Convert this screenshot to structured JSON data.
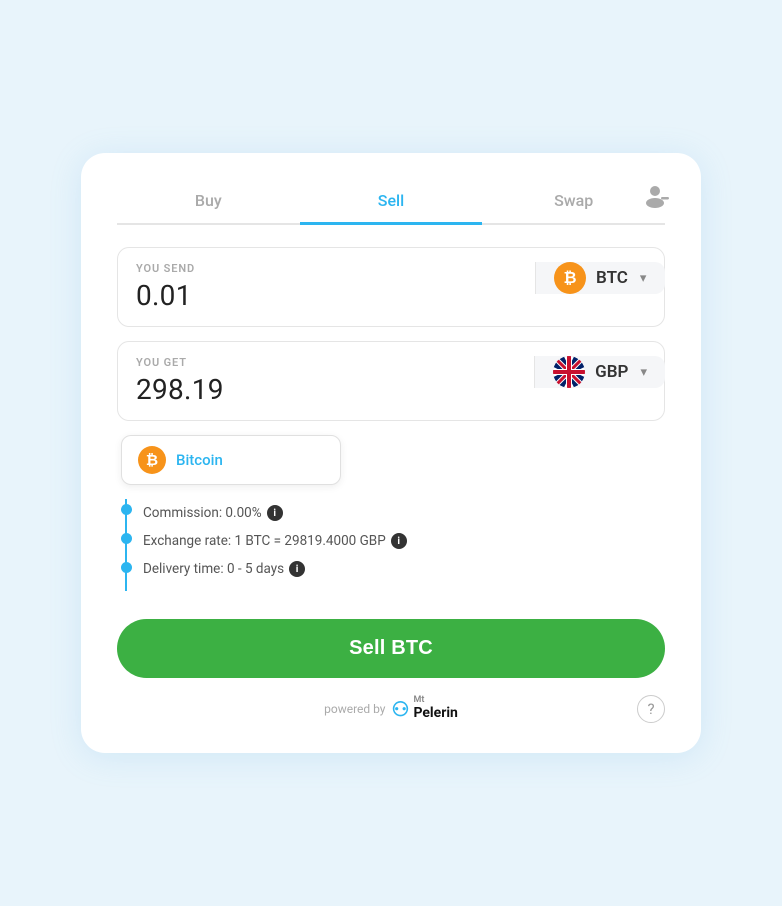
{
  "tabs": [
    {
      "id": "buy",
      "label": "Buy",
      "active": false
    },
    {
      "id": "sell",
      "label": "Sell",
      "active": true
    },
    {
      "id": "swap",
      "label": "Swap",
      "active": false
    }
  ],
  "send_field": {
    "label": "YOU SEND",
    "value": "0.01",
    "currency": "BTC",
    "currency_name": "Bitcoin"
  },
  "get_field": {
    "label": "YOU GET",
    "value": "298.19",
    "currency": "GBP"
  },
  "dropdown": {
    "label": "Bitcoin"
  },
  "info": {
    "commission": "Commission: 0.00%",
    "exchange_rate": "Exchange rate: 1 BTC = 29819.4000 GBP",
    "delivery_time": "Delivery time: 0 - 5 days"
  },
  "sell_button": {
    "label": "Sell BTC"
  },
  "footer": {
    "powered_by": "powered by",
    "brand_mt": "Mt",
    "brand_name": "Pelerin"
  },
  "icons": {
    "btc_symbol": "₿",
    "chevron_down": "▾",
    "info_symbol": "i",
    "help_symbol": "?",
    "pelerin_symbol": "⚇"
  }
}
